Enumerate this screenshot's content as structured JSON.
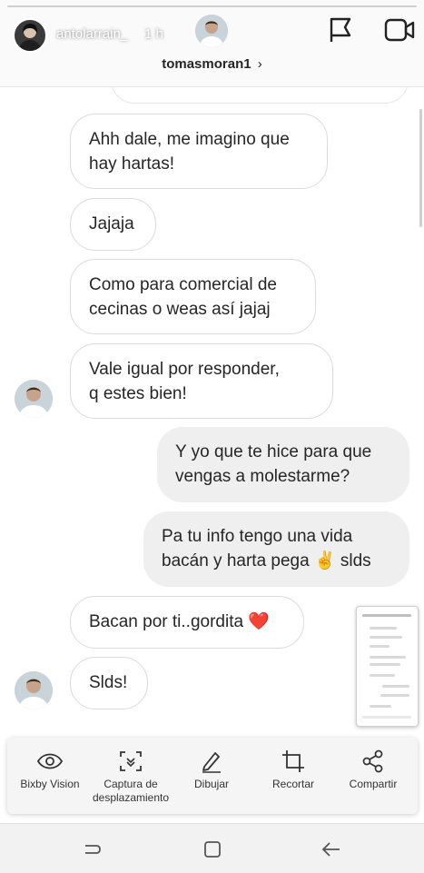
{
  "story": {
    "username": "antolarrain_",
    "time": "1 h"
  },
  "thread": {
    "title": "tomasmoran1",
    "chevron": "›"
  },
  "messages": [
    {
      "side": "in",
      "text": "Ahh dale, me imagino que\nhay hartas!"
    },
    {
      "side": "in",
      "text": "Jajaja"
    },
    {
      "side": "in",
      "text": "Como para comercial de\ncecinas o weas así jajaj"
    },
    {
      "side": "in",
      "text": "Vale igual por responder,\nq estes bien!"
    },
    {
      "side": "out",
      "text": "Y yo que te hice para que\nvengas a molestarme?"
    },
    {
      "side": "out",
      "text": "Pa tu info tengo una vida\nbacán y harta pega ✌ slds"
    },
    {
      "side": "in",
      "text": "Bacan por ti..gordita ❤️"
    },
    {
      "side": "in",
      "text": "Slds!"
    }
  ],
  "capture_toolbar": {
    "items": [
      {
        "label": "Bixby Vision",
        "icon": "eye-icon"
      },
      {
        "label": "Captura de\ndesplazamiento",
        "icon": "scroll-capture-icon"
      },
      {
        "label": "Dibujar",
        "icon": "pencil-icon"
      },
      {
        "label": "Recortar",
        "icon": "crop-icon"
      },
      {
        "label": "Compartir",
        "icon": "share-icon"
      }
    ]
  },
  "colors": {
    "outgoing_bubble": "#efefef",
    "incoming_border": "#dbdbdb",
    "text": "#262626"
  }
}
